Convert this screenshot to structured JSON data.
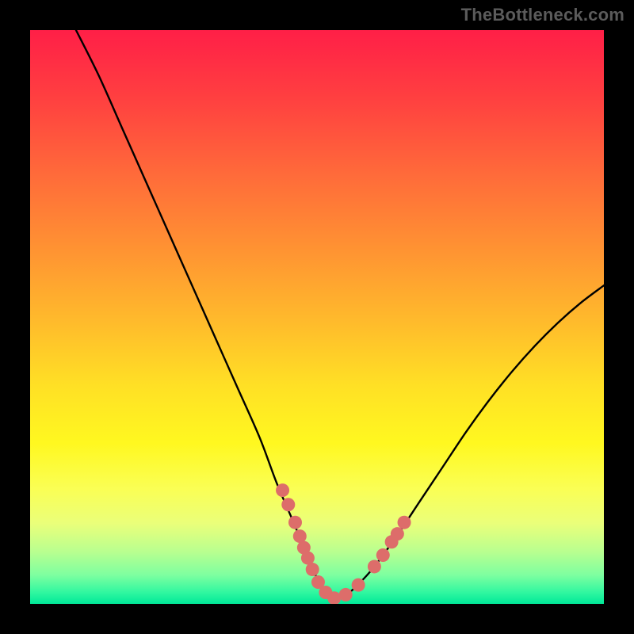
{
  "attribution": "TheBottleneck.com",
  "chart_data": {
    "type": "line",
    "title": "",
    "xlabel": "",
    "ylabel": "",
    "xlim": [
      0,
      100
    ],
    "ylim": [
      0,
      100
    ],
    "series": [
      {
        "name": "left-curve",
        "x": [
          8,
          12,
          16,
          20,
          24,
          28,
          32,
          36,
          40,
          43,
          46,
          48,
          50,
          51.5,
          53
        ],
        "y": [
          100,
          92,
          83,
          74,
          65,
          56,
          47,
          38,
          29,
          21,
          14,
          9,
          4.5,
          2,
          0.5
        ]
      },
      {
        "name": "right-curve",
        "x": [
          53,
          55,
          57,
          60,
          64,
          68,
          72,
          76,
          80,
          84,
          88,
          92,
          96,
          100
        ],
        "y": [
          0.5,
          1.5,
          3.2,
          6.5,
          12,
          18,
          24,
          30,
          35.5,
          40.5,
          45,
          49,
          52.5,
          55.5
        ]
      }
    ],
    "scatter": {
      "name": "highlight-points",
      "points": [
        {
          "x": 44.0,
          "y": 19.8
        },
        {
          "x": 45.0,
          "y": 17.3
        },
        {
          "x": 46.2,
          "y": 14.2
        },
        {
          "x": 47.0,
          "y": 11.8
        },
        {
          "x": 47.7,
          "y": 9.8
        },
        {
          "x": 48.4,
          "y": 8.0
        },
        {
          "x": 49.2,
          "y": 6.0
        },
        {
          "x": 50.2,
          "y": 3.8
        },
        {
          "x": 51.5,
          "y": 2.0
        },
        {
          "x": 53.0,
          "y": 1.0
        },
        {
          "x": 55.0,
          "y": 1.6
        },
        {
          "x": 57.2,
          "y": 3.3
        },
        {
          "x": 60.0,
          "y": 6.5
        },
        {
          "x": 61.5,
          "y": 8.5
        },
        {
          "x": 63.0,
          "y": 10.8
        },
        {
          "x": 64.0,
          "y": 12.2
        },
        {
          "x": 65.2,
          "y": 14.2
        }
      ]
    },
    "grid": false,
    "legend": false
  }
}
